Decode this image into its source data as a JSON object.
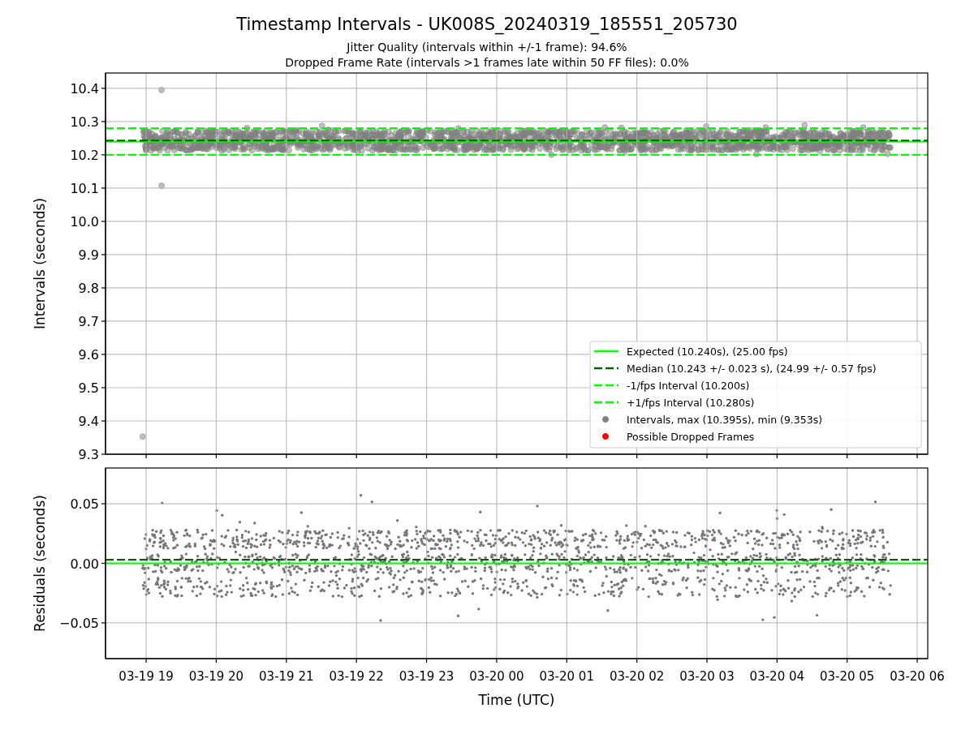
{
  "figure": {
    "title": "Timestamp Intervals - UK008S_20240319_185551_205730",
    "subtitles": [
      "Jitter Quality (intervals within +/-1 frame): 94.6%",
      "Dropped Frame Rate (intervals >1 frames late within 50 FF files): 0.0%"
    ]
  },
  "intervals_chart": {
    "chart_data": {
      "type": "scatter",
      "ylabel": "Intervals (seconds)",
      "grid": true,
      "legend": "lower right",
      "ylim": [
        9.3,
        10.446
      ],
      "categories": [
        null,
        null,
        null,
        null,
        null,
        null,
        null,
        null,
        null,
        null,
        null,
        null
      ],
      "yticks": [
        {
          "value": 9.3,
          "label": "9.3"
        },
        {
          "value": 9.4,
          "label": "9.4"
        },
        {
          "value": 9.5,
          "label": "9.5"
        },
        {
          "value": 9.6,
          "label": "9.6"
        },
        {
          "value": 9.7,
          "label": "9.7"
        },
        {
          "value": 9.8,
          "label": "9.8"
        },
        {
          "value": 9.9,
          "label": "9.9"
        },
        {
          "value": 10.0,
          "label": "10.0"
        },
        {
          "value": 10.1,
          "label": "10.1"
        },
        {
          "value": 10.2,
          "label": "10.2"
        },
        {
          "value": 10.3,
          "label": "10.3"
        },
        {
          "value": 10.4,
          "label": "10.4"
        }
      ],
      "ref_lines": [
        {
          "axis": "y",
          "value": 10.24,
          "color": "#00ff00",
          "label": "Expected (10.240s), (25.00 fps)"
        },
        {
          "axis": "y",
          "value": 10.243,
          "color": "#006400",
          "label": "Median (10.243 +/- 0.023 s), (24.99 +/- 0.57 fps)"
        },
        {
          "axis": "y",
          "value": 10.2,
          "color": "#00ff00",
          "label": "-1/fps Interval (10.200s)"
        },
        {
          "axis": "y",
          "value": 10.28,
          "color": "#00ff00",
          "label": "+1/fps Interval (10.280s)"
        }
      ]
    },
    "marker_legend": [
      {
        "label": "Intervals, max (10.395s), min (9.353s)",
        "color": "#808080"
      },
      {
        "label": "Possible Dropped Frames",
        "color": "#ff0000"
      }
    ]
  },
  "residuals_chart": {
    "chart_data": {
      "type": "scatter",
      "xlabel": "Time (UTC)",
      "ylabel": "Residuals (seconds)",
      "grid": true,
      "ylim": [
        -0.08,
        0.08
      ],
      "yticks": [
        {
          "value": -0.05,
          "label": "−0.05"
        },
        {
          "value": 0,
          "label": "0.00"
        },
        {
          "value": 0.05,
          "label": "0.05"
        }
      ],
      "categories": [
        "03-19 19",
        "03-19 20",
        "03-19 21",
        "03-19 22",
        "03-19 23",
        "03-20 00",
        "03-20 01",
        "03-20 02",
        "03-20 03",
        "03-20 04",
        "03-20 05",
        "03-20 06"
      ],
      "ref_lines": [
        {
          "axis": "y",
          "value": 0,
          "color": "#00ff00"
        },
        {
          "axis": "y",
          "value": 0.003,
          "color": "#006400"
        }
      ]
    }
  }
}
